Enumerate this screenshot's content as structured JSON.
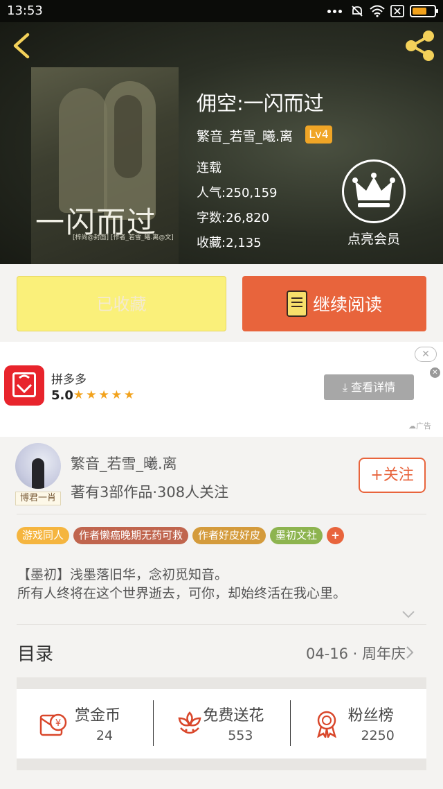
{
  "status_bar": {
    "time": "13:53"
  },
  "book": {
    "title": "佣空:一闪而过",
    "cover_title": "一闪而过",
    "cover_subtitle": "[梓尚@封面]   [作者_若雪_曦.离@文]",
    "author": "繁音_若雪_曦.离",
    "level": "Lv4",
    "status": "连载",
    "stats": [
      {
        "label": "人气:",
        "value": "250,159"
      },
      {
        "label": "字数:",
        "value": "26,820"
      },
      {
        "label": "收藏:",
        "value": "2,135"
      }
    ]
  },
  "member": {
    "label": "点亮会员",
    "icon": "crown-icon"
  },
  "actions": {
    "collected_label": "已收藏",
    "read_label": "继续阅读"
  },
  "ad": {
    "app_name": "拼多多",
    "rating": "5.0",
    "stars": "★★★★★",
    "detail_label": "查看详情",
    "close_label": "✕",
    "tag": "广告",
    "brand_color": "#e8242c"
  },
  "author_card": {
    "name": "繁音_若雪_曦.离",
    "info": "著有3部作品·308人关注",
    "avatar_tag": "博君一肖",
    "follow_label": "+关注"
  },
  "tags": [
    {
      "label": "游戏同人",
      "color": "#f5b53f"
    },
    {
      "label": "作者懒癌晚期无药可救",
      "color": "#c0654e"
    },
    {
      "label": "作者好皮好皮",
      "color": "#d49b3c"
    },
    {
      "label": "墨初文社",
      "color": "#8db44f"
    },
    {
      "label": "+",
      "color": "#e8643c"
    }
  ],
  "intro": [
    "【墨初】浅墨落旧华，念初觅知音。",
    "所有人终将在这个世界逝去，可你，却始终活在我心里。"
  ],
  "catalog": {
    "title": "目录",
    "update": "04-16 · 周年庆"
  },
  "rewards": [
    {
      "label": "赏金币",
      "value": "24",
      "icon": "coin-envelope-icon"
    },
    {
      "label": "免费送花",
      "value": "553",
      "icon": "flower-icon"
    },
    {
      "label": "粉丝榜",
      "value": "2250",
      "icon": "medal-icon"
    }
  ],
  "accent_color": "#e8643c"
}
